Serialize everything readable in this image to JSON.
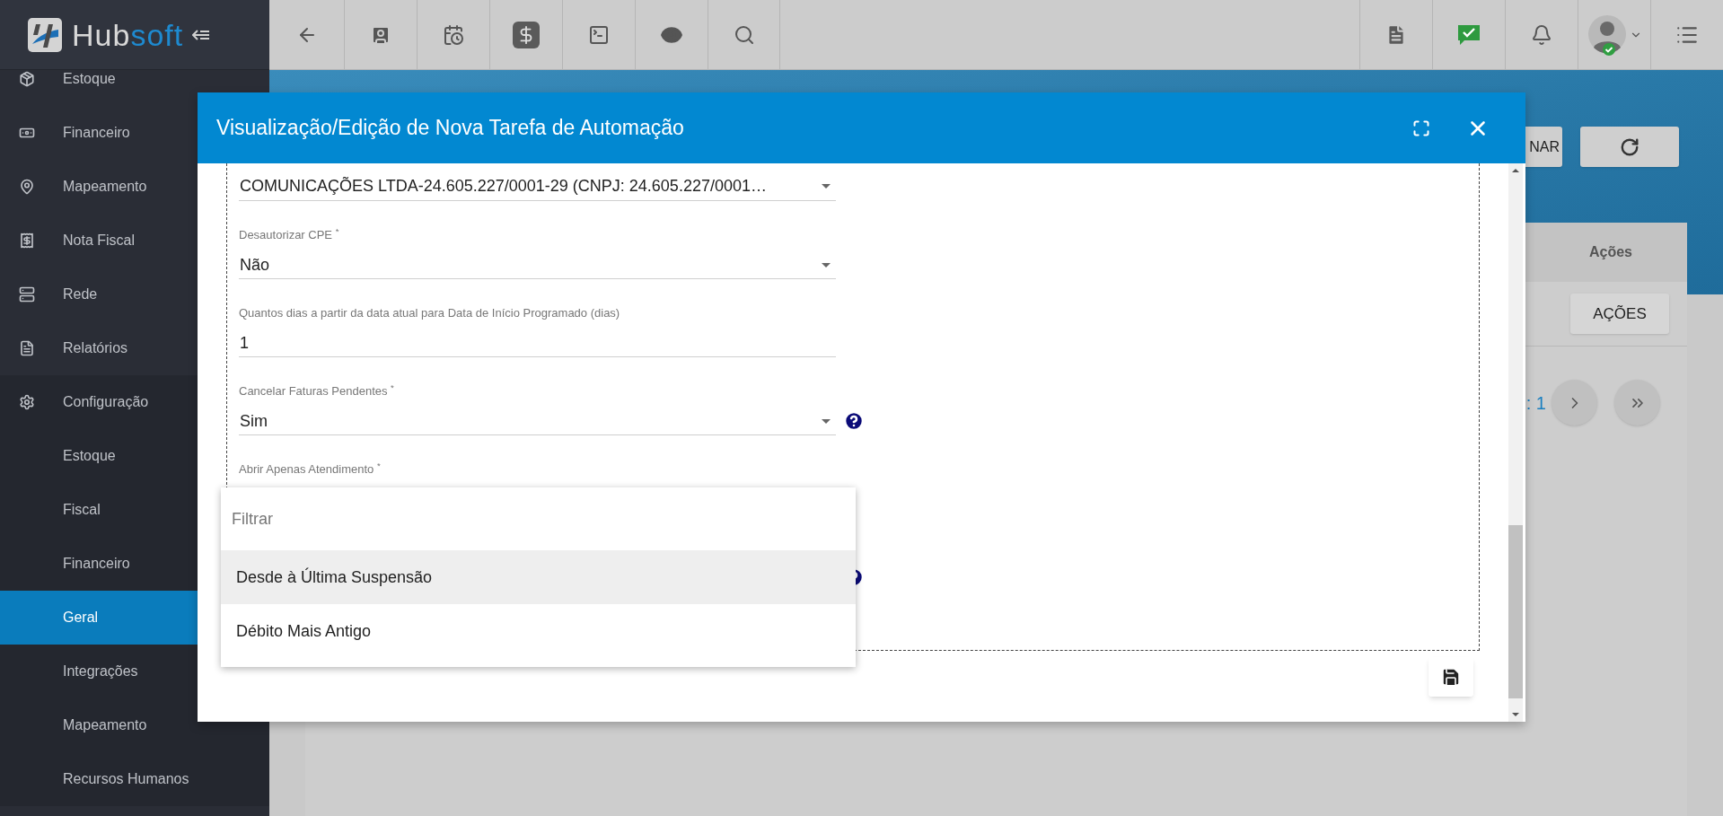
{
  "brand": {
    "name": "Hub",
    "accent": "soft"
  },
  "sidebar": {
    "items": [
      {
        "label": "Estoque",
        "selected": false
      },
      {
        "label": "Financeiro",
        "selected": false
      },
      {
        "label": "Mapeamento",
        "selected": false
      },
      {
        "label": "Nota Fiscal",
        "selected": false
      },
      {
        "label": "Rede",
        "selected": false
      },
      {
        "label": "Relatórios",
        "selected": false
      },
      {
        "label": "Configuração",
        "selected": false,
        "expanded": true,
        "children": [
          {
            "label": "Estoque",
            "selected": false
          },
          {
            "label": "Fiscal",
            "selected": false
          },
          {
            "label": "Financeiro",
            "selected": false
          },
          {
            "label": "Geral",
            "selected": true
          },
          {
            "label": "Integrações",
            "selected": false
          },
          {
            "label": "Mapeamento",
            "selected": false
          },
          {
            "label": "Recursos Humanos",
            "selected": false
          }
        ]
      }
    ]
  },
  "page": {
    "header_button": "NAR",
    "column": "Ações",
    "row_button": "AÇÕES",
    "pagination": ": 1"
  },
  "modal": {
    "title": "Visualização/Edição de Nova Tarefa de Automação",
    "fields": [
      {
        "kind": "select",
        "value": "COMUNICAÇÕES LTDA-24.605.227/0001-29 (CNPJ: 24.605.227/0001…",
        "help": false
      },
      {
        "kind": "select",
        "label": "Desautorizar CPE $^{*}$",
        "value": "Não",
        "help": false
      },
      {
        "kind": "input",
        "label": "Quantos dias a partir da data atual para Data de Início Programado (dias)",
        "value": "1",
        "help": false
      },
      {
        "kind": "select",
        "label": "Cancelar Faturas Pendentes $^{*}$",
        "value": "Sim",
        "help": true
      },
      {
        "label": "Abrir Apenas Atendimento $^{*}$",
        "help": false
      },
      {
        "help": true
      }
    ],
    "dropdown": {
      "filter_placeholder": "Filtrar",
      "options": [
        {
          "label": "Desde à Última Suspensão",
          "selected": true
        },
        {
          "label": "Débito Mais Antigo",
          "selected": false
        }
      ]
    }
  }
}
